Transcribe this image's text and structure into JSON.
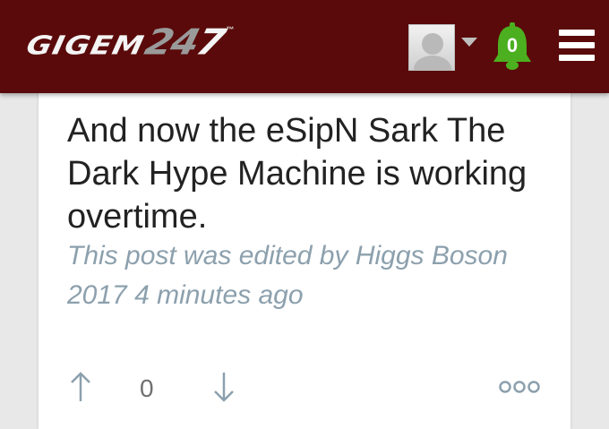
{
  "header": {
    "logo_text": "GIGEM",
    "logo_number_prefix": "24",
    "logo_number_suffix": "7",
    "logo_tm": "™",
    "notification_count": "0",
    "colors": {
      "background": "#5a0a0a",
      "bell": "#4caf1f",
      "menu": "#ffffff"
    }
  },
  "post": {
    "text": "And now the eSipN Sark The Dark Hype Machine is working overtime.",
    "edited_note": "This post was edited by Higgs Boson 2017 4 minutes ago",
    "vote_count": "0",
    "colors": {
      "text": "#222222",
      "edited": "#8ca0ad",
      "vote_icons": "#8ca0ad"
    }
  },
  "icons": {
    "upvote": "arrow-up-icon",
    "downvote": "arrow-down-icon",
    "more": "more-options-icon",
    "notifications": "bell-icon",
    "menu": "hamburger-menu-icon",
    "avatar": "user-avatar-icon",
    "caret": "chevron-down-icon"
  }
}
